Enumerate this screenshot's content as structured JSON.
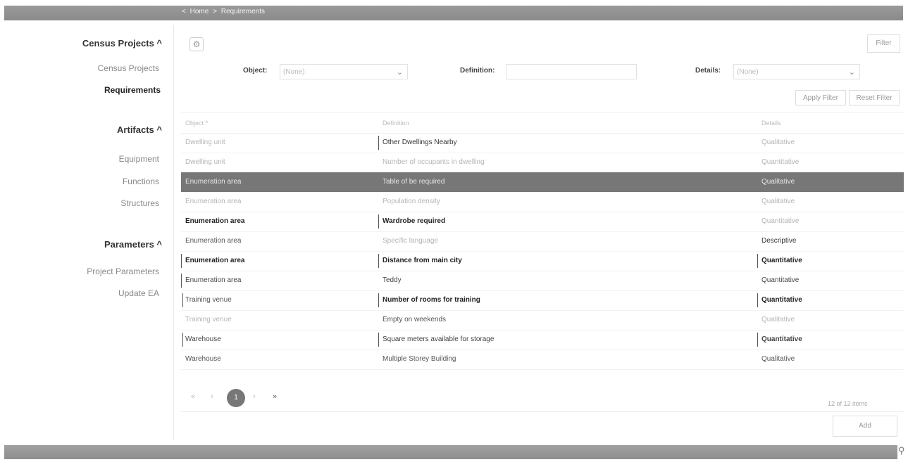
{
  "breadcrumb": {
    "back": "<",
    "home": "Home",
    "sep": ">",
    "current": "Requirements"
  },
  "sidebar": {
    "sections": [
      {
        "title": "Census Projects ^",
        "items": [
          {
            "label": "Census Projects",
            "active": false
          },
          {
            "label": "Requirements",
            "active": true
          }
        ]
      },
      {
        "title": "Artifacts ^",
        "items": [
          {
            "label": "Equipment"
          },
          {
            "label": "Functions"
          },
          {
            "label": "Structures"
          }
        ]
      },
      {
        "title": "Parameters ^",
        "items": [
          {
            "label": "Project Parameters"
          },
          {
            "label": "Update EA"
          }
        ]
      }
    ]
  },
  "toolbar": {
    "gear_icon": "gear-icon",
    "filter_label": "Filter"
  },
  "filters": {
    "object_label": "Object:",
    "object_value": "(None)",
    "definition_label": "Definition:",
    "definition_value": "",
    "details_label": "Details:",
    "details_value": "(None)",
    "chevron": "⌄",
    "apply_label": "Apply Filter",
    "reset_label": "Reset Filter"
  },
  "table": {
    "headers": {
      "object": "Object ^",
      "definition": "Definition",
      "details": "Details"
    },
    "rows": [
      {
        "object": "Dwelling unit",
        "definition": "Other Dwellings Nearby",
        "details": "Qualitative"
      },
      {
        "object": "Dwelling unit",
        "definition": "Number of occupants in dwelling",
        "details": "Quantitative"
      },
      {
        "object": "Enumeration area",
        "definition": "Table of be required",
        "details": "Qualitative"
      },
      {
        "object": "Enumeration area",
        "definition": "Population density",
        "details": "Qualitative"
      },
      {
        "object": "Enumeration area",
        "definition": "Wardrobe required",
        "details": "Quantitative"
      },
      {
        "object": "Enumeration area",
        "definition": "Specific language",
        "details": "Descriptive"
      },
      {
        "object": "Enumeration area",
        "definition": "Distance from main city",
        "details": "Quantitative"
      },
      {
        "object": "Enumeration area",
        "definition": "Teddy",
        "details": "Quantitative"
      },
      {
        "object": "Training venue",
        "definition": "Number of rooms for training",
        "details": "Quantitative"
      },
      {
        "object": "Training venue",
        "definition": "Empty on weekends",
        "details": "Qualitative"
      },
      {
        "object": "Warehouse",
        "definition": "Square meters available for storage",
        "details": "Quantitative"
      },
      {
        "object": "Warehouse",
        "definition": "Multiple Storey Building",
        "details": "Qualitative"
      }
    ]
  },
  "pager": {
    "first": "«",
    "prev": "‹",
    "page": "1",
    "next": "›",
    "last": "»",
    "count": "12 of 12 items"
  },
  "actions": {
    "add_label": "Add"
  }
}
